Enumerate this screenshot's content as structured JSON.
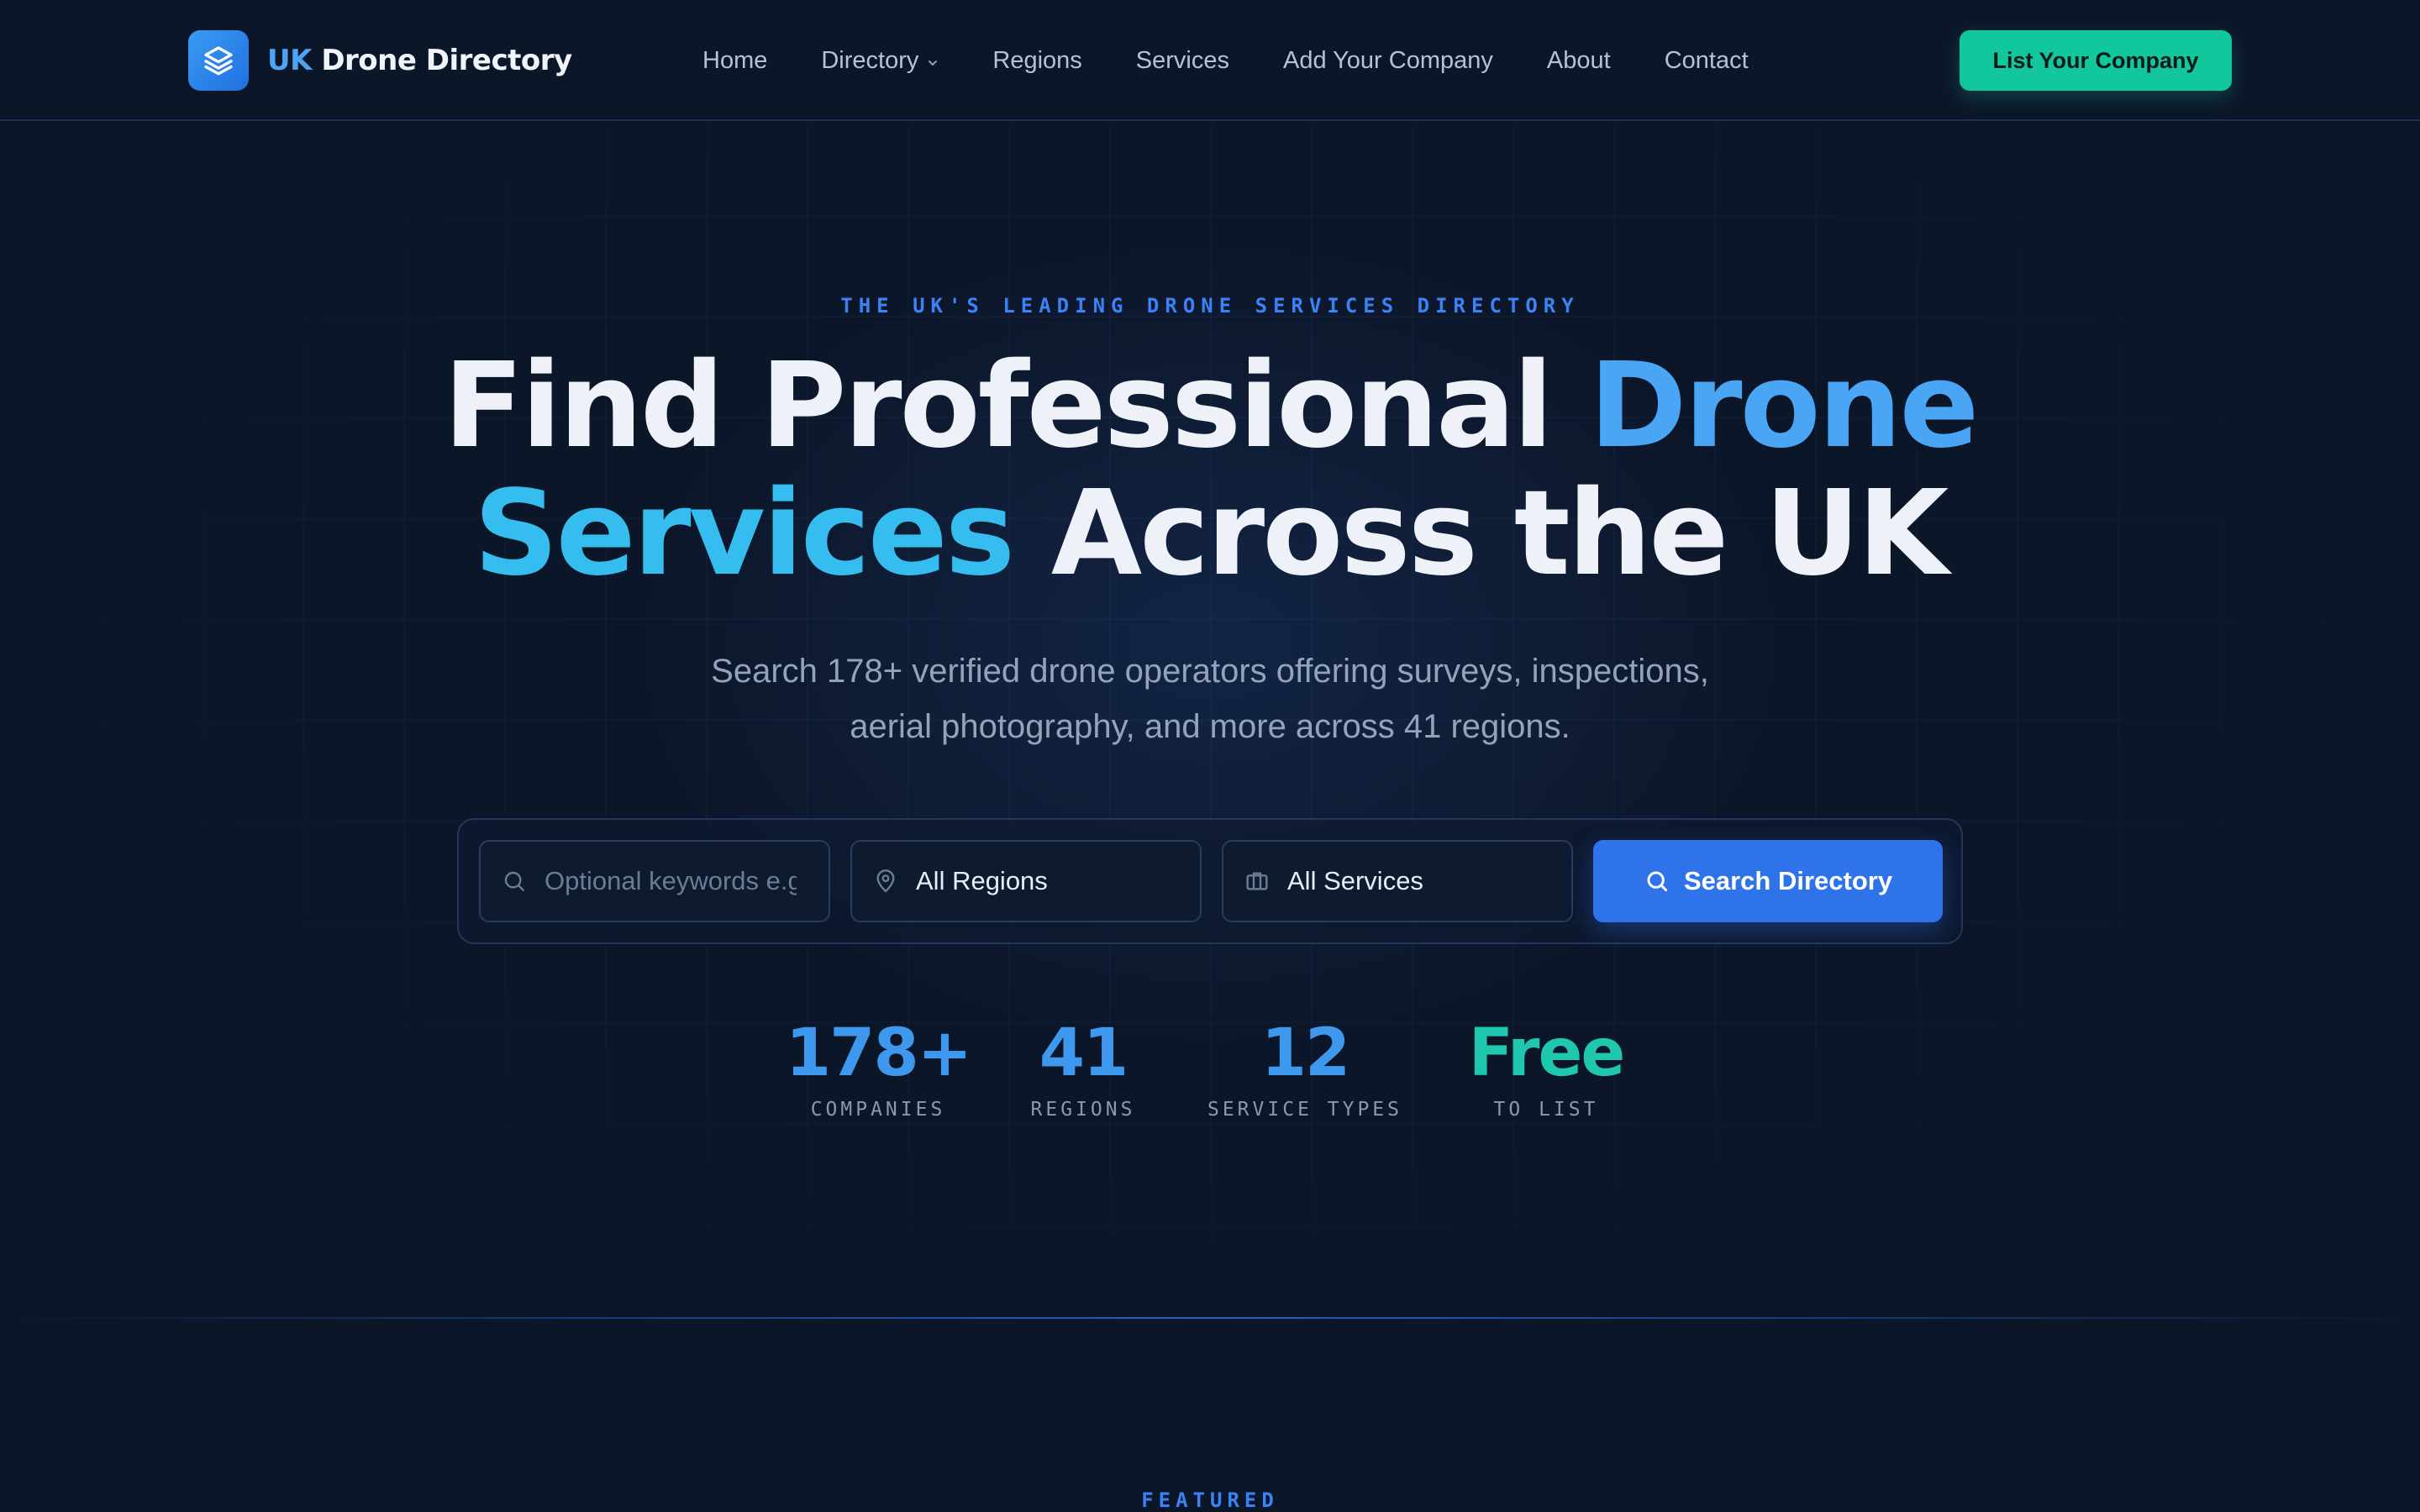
{
  "brand": {
    "prefix": "UK",
    "name": "Drone Directory",
    "logo_icon": "layers-icon"
  },
  "nav": {
    "links": [
      {
        "label": "Home"
      },
      {
        "label": "Directory",
        "has_dropdown": true
      },
      {
        "label": "Regions"
      },
      {
        "label": "Services"
      },
      {
        "label": "Add Your Company"
      },
      {
        "label": "About"
      },
      {
        "label": "Contact"
      }
    ],
    "cta_label": "List Your Company"
  },
  "hero": {
    "eyebrow": "THE UK'S LEADING DRONE SERVICES DIRECTORY",
    "headline_part1": "Find Professional ",
    "headline_accent1": "Drone",
    "headline_accent2": "Services",
    "headline_part2": " Across the UK",
    "subtitle_line1": "Search 178+ verified drone operators offering surveys, inspections,",
    "subtitle_line2": "aerial photography, and more across 41 regions."
  },
  "search": {
    "keywords_placeholder": "Optional keywords e.g.",
    "keywords_value": "",
    "region_value": "All Regions",
    "service_value": "All Services",
    "button_label": "Search Directory"
  },
  "stats": [
    {
      "value": "178+",
      "label": "COMPANIES"
    },
    {
      "value": "41",
      "label": "REGIONS"
    },
    {
      "value": "12",
      "label": "SERVICE TYPES"
    },
    {
      "value": "Free",
      "label": "TO LIST"
    }
  ],
  "featured": {
    "label": "FEATURED"
  },
  "colors": {
    "background": "#0c1629",
    "accent_blue": "#2f73ea",
    "accent_green": "#13c79c",
    "heading_accent": "#4aa6f4",
    "stat_free": "#1fc7ae"
  }
}
